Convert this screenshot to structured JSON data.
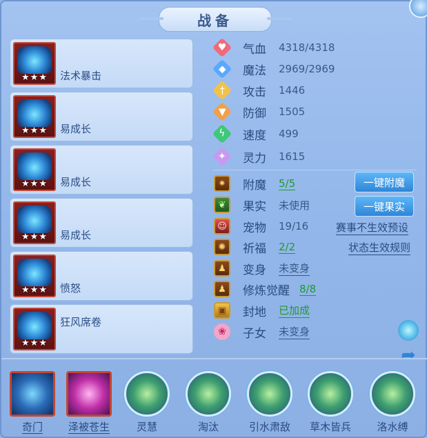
{
  "header": {
    "title": "战备"
  },
  "slots": [
    {
      "label": "法术暴击",
      "stars": "★★★"
    },
    {
      "label": "易成长",
      "stars": "★★★"
    },
    {
      "label": "易成长",
      "stars": "★★★"
    },
    {
      "label": "易成长",
      "stars": "★★★"
    },
    {
      "label": "愤怒",
      "stars": "★★★"
    },
    {
      "label": "狂风席卷",
      "stars": "★★★"
    }
  ],
  "stats": [
    {
      "name": "气血",
      "value": "4318/4318",
      "icon": "heart-icon",
      "color": "#f06a7a"
    },
    {
      "name": "魔法",
      "value": "2969/2969",
      "icon": "mana-icon",
      "color": "#5aa8ff"
    },
    {
      "name": "攻击",
      "value": "1446",
      "icon": "sword-icon",
      "color": "#f2c247"
    },
    {
      "name": "防御",
      "value": "1505",
      "icon": "shield-icon",
      "color": "#f0a04a"
    },
    {
      "name": "速度",
      "value": "499",
      "icon": "lightning-icon",
      "color": "#3ec87a"
    },
    {
      "name": "灵力",
      "value": "1615",
      "icon": "spirit-icon",
      "color": "#c79af0"
    }
  ],
  "attrs": [
    {
      "name": "附魔",
      "value": "5/5",
      "style": "green-under",
      "icon": "enchant-icon"
    },
    {
      "name": "果实",
      "value": "未使用",
      "style": "plain",
      "icon": "fruit-icon"
    },
    {
      "name": "宠物",
      "value": "19/16",
      "style": "plain",
      "icon": "pet-icon"
    },
    {
      "name": "祈福",
      "value": "2/2",
      "style": "green-under",
      "icon": "bless-icon"
    },
    {
      "name": "变身",
      "value": "未变身",
      "style": "under",
      "icon": "transform-icon"
    },
    {
      "name": "修炼觉醒",
      "value": "8/8",
      "style": "green-under",
      "icon": "awaken-icon"
    },
    {
      "name": "封地",
      "value": "已加成",
      "style": "green-under",
      "icon": "fief-icon"
    },
    {
      "name": "子女",
      "value": "未变身",
      "style": "under",
      "icon": "child-icon"
    }
  ],
  "buttons": {
    "enchant": "一键附魔",
    "fruit": "一键果实"
  },
  "links": {
    "event": "赛事不生效预设",
    "rules": "状态生效规则"
  },
  "skills": [
    {
      "name": "奇门",
      "kind": "sq",
      "underline": true
    },
    {
      "name": "泽被苍生",
      "kind": "sq-pink",
      "underline": true
    },
    {
      "name": "灵慧",
      "kind": "circ",
      "underline": false
    },
    {
      "name": "淘汰",
      "kind": "circ",
      "underline": false
    },
    {
      "name": "引水肃敌",
      "kind": "circ",
      "underline": false
    },
    {
      "name": "草木皆兵",
      "kind": "circ",
      "underline": false
    },
    {
      "name": "洛水缚",
      "kind": "circ",
      "underline": false
    }
  ]
}
